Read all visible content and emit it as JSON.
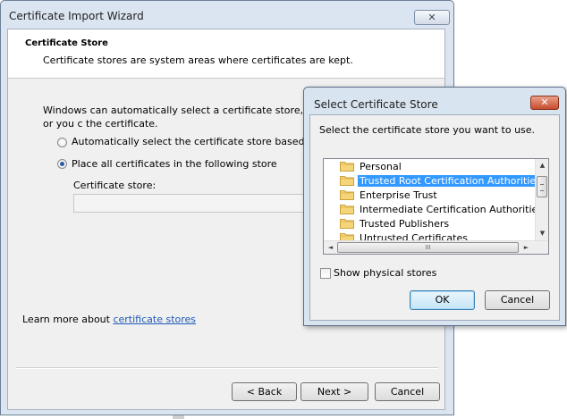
{
  "wizard": {
    "title": "Certificate Import Wizard",
    "close_glyph": "✕",
    "header_title": "Certificate Store",
    "header_desc": "Certificate stores are system areas where certificates are kept.",
    "body_text": "Windows can automatically select a certificate store, or you c the certificate.",
    "radio_auto": "Automatically select the certificate store based on the",
    "radio_place": "Place all certificates in the following store",
    "store_label": "Certificate store:",
    "store_value": "",
    "learn_prefix": "Learn more about ",
    "learn_link": "certificate stores",
    "back_label": "< Back",
    "next_label": "Next >",
    "cancel_label": "Cancel"
  },
  "dialog": {
    "title": "Select Certificate Store",
    "close_glyph": "✕",
    "description": "Select the certificate store you want to use.",
    "stores": [
      {
        "label": "Personal",
        "selected": false
      },
      {
        "label": "Trusted Root Certification Authorities",
        "selected": true
      },
      {
        "label": "Enterprise Trust",
        "selected": false
      },
      {
        "label": "Intermediate Certification Authorities",
        "selected": false
      },
      {
        "label": "Trusted Publishers",
        "selected": false
      },
      {
        "label": "Untrusted Certificates",
        "selected": false
      }
    ],
    "scroll_up": "▲",
    "scroll_down": "▼",
    "scroll_left": "◄",
    "scroll_right": "►",
    "hscroll_grip": "III",
    "show_physical_label": "Show physical stores",
    "show_physical_checked": false,
    "ok_label": "OK",
    "cancel_label": "Cancel"
  },
  "colors": {
    "selection": "#3399ff",
    "link": "#1c58b5",
    "window_frame": "#dbe5f1",
    "close_red": "#c74d2e"
  },
  "icons": {
    "store_item": "folder-icon"
  }
}
